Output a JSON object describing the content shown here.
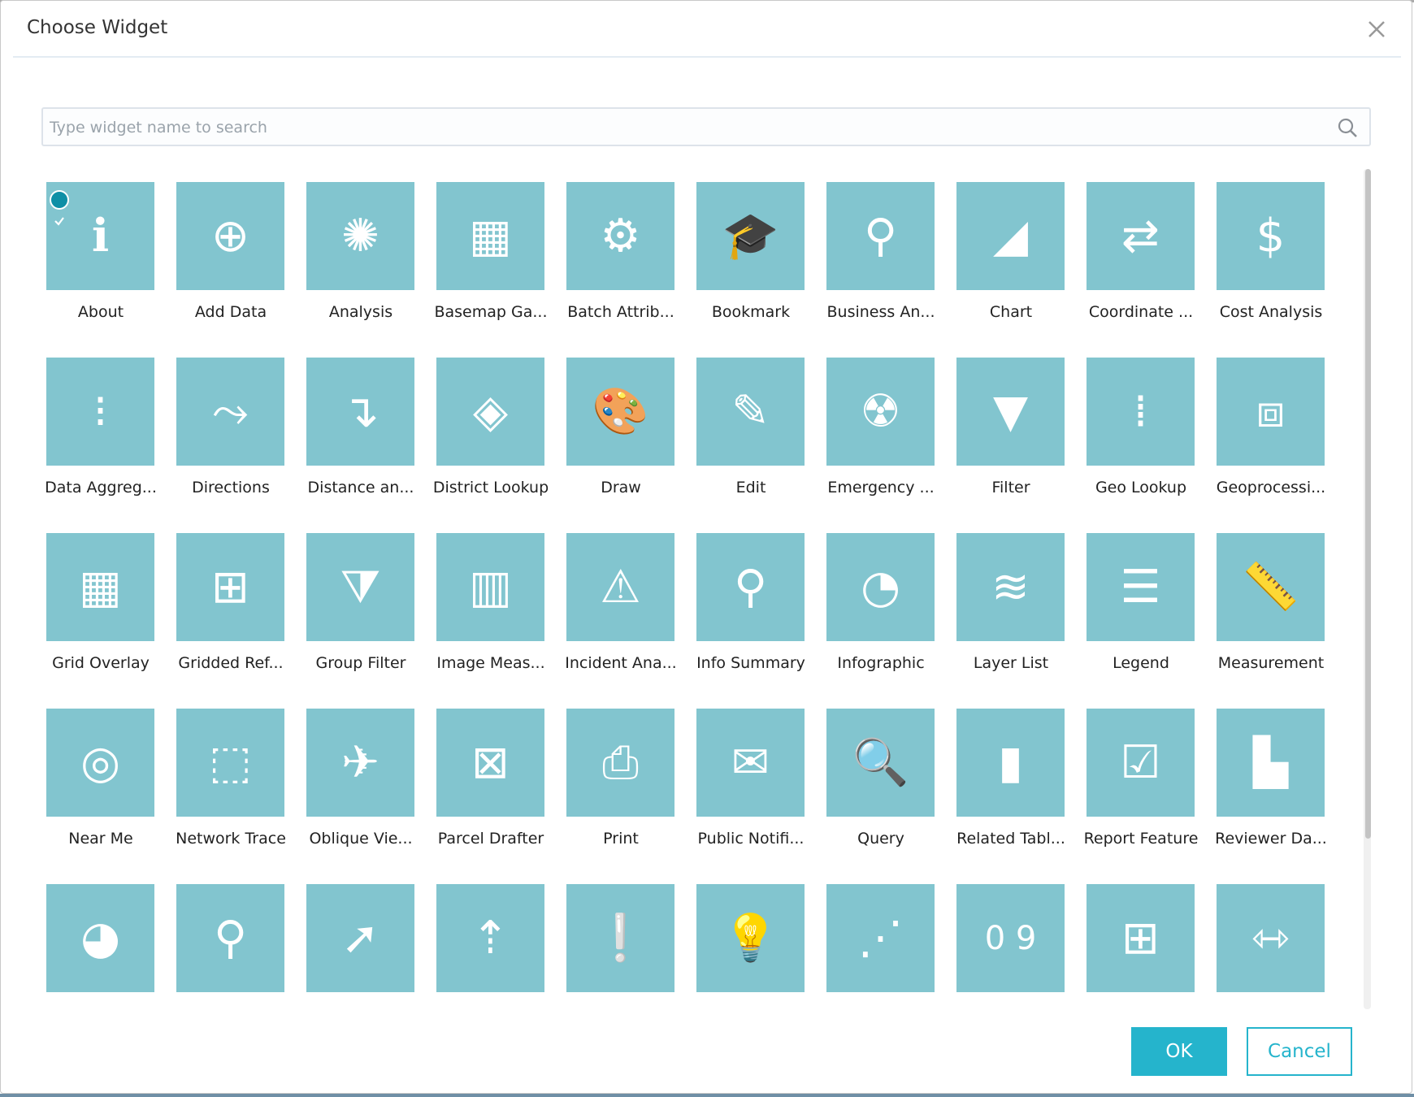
{
  "dialog": {
    "title": "Choose Widget"
  },
  "search": {
    "placeholder": "Type widget name to search",
    "value": ""
  },
  "colors": {
    "tile": "#82c5cf",
    "accent": "#25b4cc",
    "check": "#0e8fa6"
  },
  "widgets": [
    {
      "label": "About",
      "icon": "info-icon",
      "glyph": "ℹ",
      "selected": true
    },
    {
      "label": "Add Data",
      "icon": "add-data-icon",
      "glyph": "⊕"
    },
    {
      "label": "Analysis",
      "icon": "analysis-icon",
      "glyph": "✺"
    },
    {
      "label": "Basemap Ga...",
      "icon": "basemap-gallery-icon",
      "glyph": "▦"
    },
    {
      "label": "Batch Attrib...",
      "icon": "batch-attribute-icon",
      "glyph": "⚙"
    },
    {
      "label": "Bookmark",
      "icon": "bookmark-icon",
      "glyph": "🎓"
    },
    {
      "label": "Business An...",
      "icon": "business-analyst-icon",
      "glyph": "⚲"
    },
    {
      "label": "Chart",
      "icon": "chart-icon",
      "glyph": "◢"
    },
    {
      "label": "Coordinate ...",
      "icon": "coordinate-icon",
      "glyph": "⇄"
    },
    {
      "label": "Cost Analysis",
      "icon": "cost-analysis-icon",
      "glyph": "$"
    },
    {
      "label": "Data Aggreg...",
      "icon": "data-aggregation-icon",
      "glyph": "⁝"
    },
    {
      "label": "Directions",
      "icon": "directions-icon",
      "glyph": "⤳"
    },
    {
      "label": "Distance an...",
      "icon": "distance-icon",
      "glyph": "↴"
    },
    {
      "label": "District Lookup",
      "icon": "district-lookup-icon",
      "glyph": "◈"
    },
    {
      "label": "Draw",
      "icon": "draw-palette-icon",
      "glyph": "🎨"
    },
    {
      "label": "Edit",
      "icon": "edit-icon",
      "glyph": "✎"
    },
    {
      "label": "Emergency ...",
      "icon": "emergency-icon",
      "glyph": "☢"
    },
    {
      "label": "Filter",
      "icon": "filter-icon",
      "glyph": "▼"
    },
    {
      "label": "Geo Lookup",
      "icon": "geo-lookup-icon",
      "glyph": "⁞"
    },
    {
      "label": "Geoprocessi...",
      "icon": "toolbox-icon",
      "glyph": "⧈"
    },
    {
      "label": "Grid Overlay",
      "icon": "grid-overlay-icon",
      "glyph": "▦"
    },
    {
      "label": "Gridded Ref...",
      "icon": "gridded-reference-icon",
      "glyph": "⊞"
    },
    {
      "label": "Group Filter",
      "icon": "group-filter-icon",
      "glyph": "⧩"
    },
    {
      "label": "Image Meas...",
      "icon": "image-measurement-icon",
      "glyph": "▥"
    },
    {
      "label": "Incident Ana...",
      "icon": "warning-icon",
      "glyph": "⚠"
    },
    {
      "label": "Info Summary",
      "icon": "info-summary-icon",
      "glyph": "⚲"
    },
    {
      "label": "Infographic",
      "icon": "infographic-icon",
      "glyph": "◔"
    },
    {
      "label": "Layer List",
      "icon": "layers-icon",
      "glyph": "≋"
    },
    {
      "label": "Legend",
      "icon": "legend-icon",
      "glyph": "☰"
    },
    {
      "label": "Measurement",
      "icon": "ruler-icon",
      "glyph": "📏"
    },
    {
      "label": "Near Me",
      "icon": "near-me-icon",
      "glyph": "◎"
    },
    {
      "label": "Network Trace",
      "icon": "network-trace-icon",
      "glyph": "⬚"
    },
    {
      "label": "Oblique Vie...",
      "icon": "oblique-viewer-icon",
      "glyph": "✈"
    },
    {
      "label": "Parcel Drafter",
      "icon": "parcel-drafter-icon",
      "glyph": "⊠"
    },
    {
      "label": "Print",
      "icon": "print-icon",
      "glyph": "⎙"
    },
    {
      "label": "Public Notifi...",
      "icon": "envelope-icon",
      "glyph": "✉"
    },
    {
      "label": "Query",
      "icon": "query-icon",
      "glyph": "🔍"
    },
    {
      "label": "Related Tabl...",
      "icon": "related-table-icon",
      "glyph": "▮"
    },
    {
      "label": "Report Feature",
      "icon": "report-feature-icon",
      "glyph": "☑"
    },
    {
      "label": "Reviewer Da...",
      "icon": "reviewer-dashboard-icon",
      "glyph": "▙"
    },
    {
      "label": "",
      "icon": "screening-icon",
      "glyph": "◕"
    },
    {
      "label": "",
      "icon": "search-icon",
      "glyph": "⚲"
    },
    {
      "label": "",
      "icon": "select-icon",
      "glyph": "➚"
    },
    {
      "label": "",
      "icon": "share-icon",
      "glyph": "⇡"
    },
    {
      "label": "",
      "icon": "situation-awareness-icon",
      "glyph": "❕"
    },
    {
      "label": "",
      "icon": "smart-editor-icon",
      "glyph": "💡"
    },
    {
      "label": "",
      "icon": "stream-icon",
      "glyph": "⋰"
    },
    {
      "label": "",
      "icon": "swipe-counter-icon",
      "glyph": "0 9"
    },
    {
      "label": "",
      "icon": "calculator-icon",
      "glyph": "⊞"
    },
    {
      "label": "",
      "icon": "swipe-icon",
      "glyph": "⇿"
    }
  ],
  "buttons": {
    "ok": "OK",
    "cancel": "Cancel"
  }
}
